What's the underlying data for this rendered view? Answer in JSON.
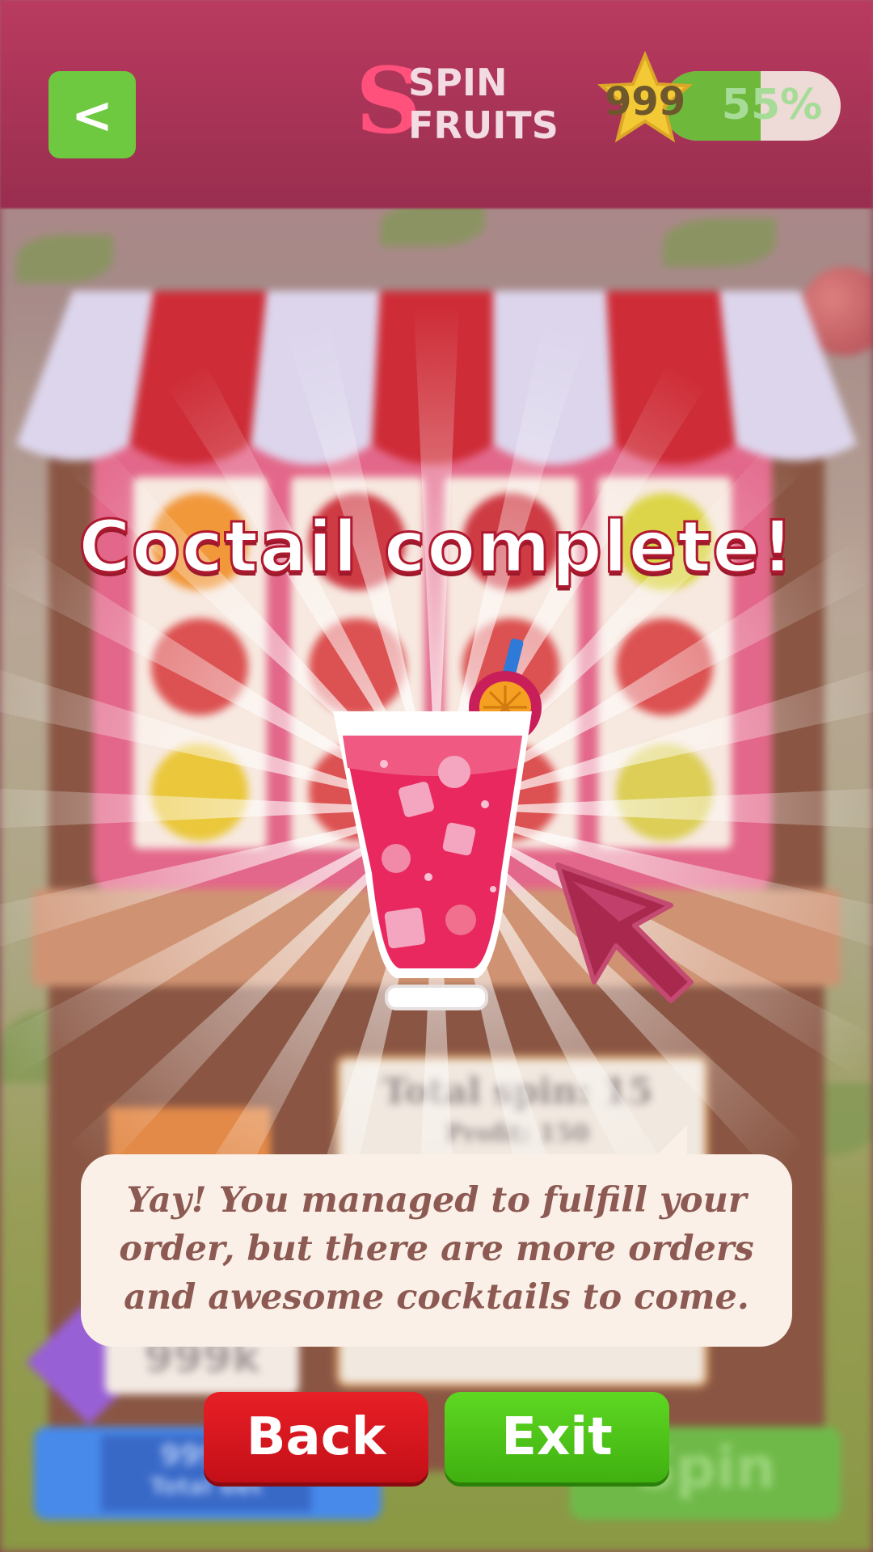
{
  "header": {
    "back_arrow": "<",
    "logo_letter": "S",
    "logo_line1": "SPIN",
    "logo_line2": "FRUITS",
    "star_value": "999",
    "level_progress_text": "55%",
    "level_progress": 0.55
  },
  "background": {
    "board_line1": "Total spin: 15",
    "board_line2": "Profit: 150",
    "coins": "999k",
    "bet_value": "999.9",
    "bet_label": "Total bet",
    "spin_label": "Spin"
  },
  "modal": {
    "title": "Coctail complete!",
    "message": "Yay! You managed to fulfill your order, but there are more orders and awesome cocktails to come.",
    "back_label": "Back",
    "exit_label": "Exit"
  },
  "colors": {
    "header": "#a01a44",
    "back_button": "#e81f26",
    "exit_button": "#4cc41a",
    "level_fill": "#5ab020",
    "bubble": "#faf0e8",
    "message_text": "#8c5a52"
  },
  "icons": [
    "back-arrow-icon",
    "star-icon",
    "cocktail-icon",
    "pointer-arrow-icon",
    "diamond-icon"
  ]
}
